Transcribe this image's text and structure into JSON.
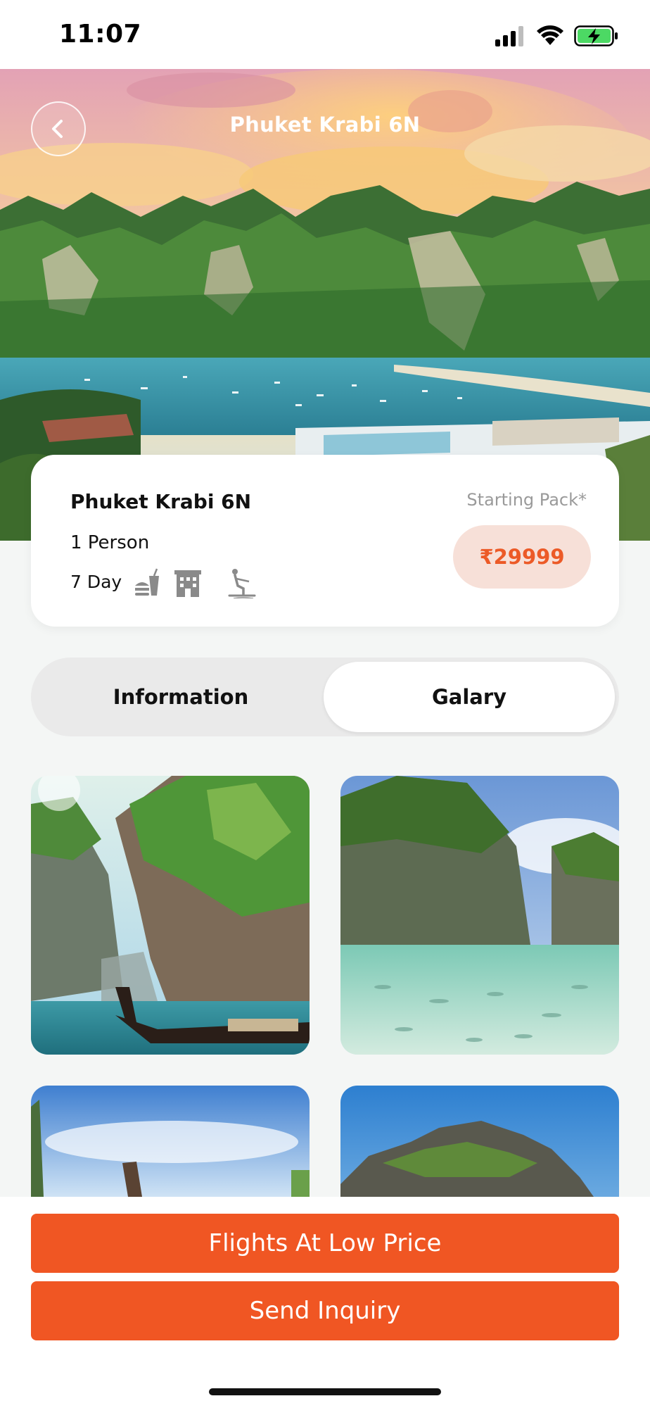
{
  "status_bar": {
    "time": "11:07",
    "icons": [
      "cellular-signal-icon",
      "wifi-icon",
      "battery-charging-icon"
    ]
  },
  "header": {
    "title": "Phuket Krabi 6N",
    "back_icon": "chevron-left-icon"
  },
  "package": {
    "name": "Phuket Krabi 6N",
    "persons": "1 Person",
    "duration": "7 Day",
    "amenities": [
      "food-drink-icon",
      "hotel-icon",
      "water-ski-icon"
    ],
    "price_label": "Starting Pack*",
    "price": "₹29999"
  },
  "tabs": [
    {
      "label": "Information",
      "selected": false
    },
    {
      "label": "Galary",
      "selected": true
    }
  ],
  "gallery": {
    "photos": [
      "longtail-boat-cliffs",
      "limestone-islands-fish",
      "beach-longtail-boat",
      "rocky-island-sea"
    ]
  },
  "actions": {
    "flights_label": "Flights At Low Price",
    "inquiry_label": "Send Inquiry"
  },
  "colors": {
    "accent": "#f05623",
    "price_bg": "#f7e0d8",
    "price_text": "#ec5a27"
  }
}
